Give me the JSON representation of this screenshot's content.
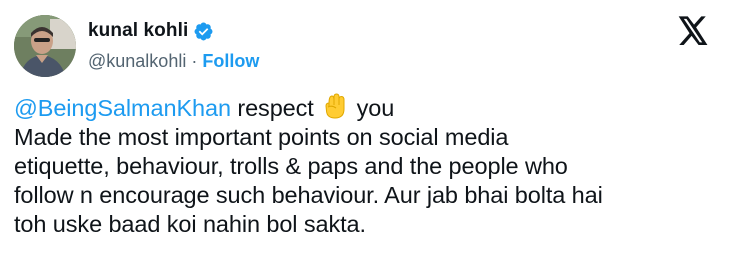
{
  "author": {
    "display_name": "kunal kohli",
    "handle": "@kunalkohli",
    "separator": "·",
    "follow_label": "Follow"
  },
  "tweet": {
    "mention": "@BeingSalmanKhan",
    "line1_after_mention": " respect ",
    "emoji": "raised-fist",
    "line1_end": " you",
    "lines": [
      "Made the most important points on social media",
      "etiquette, behaviour, trolls & paps and the people who",
      "follow n encourage such behaviour. Aur jab bhai bolta hai",
      "toh uske baad koi nahin bol sakta."
    ]
  },
  "colors": {
    "accent": "#1d9bf0",
    "text": "#0f1419",
    "secondary": "#536471"
  },
  "icons": {
    "verified": "verified-badge-icon",
    "platform": "x-logo-icon",
    "emoji": "raised-fist-emoji-icon"
  }
}
